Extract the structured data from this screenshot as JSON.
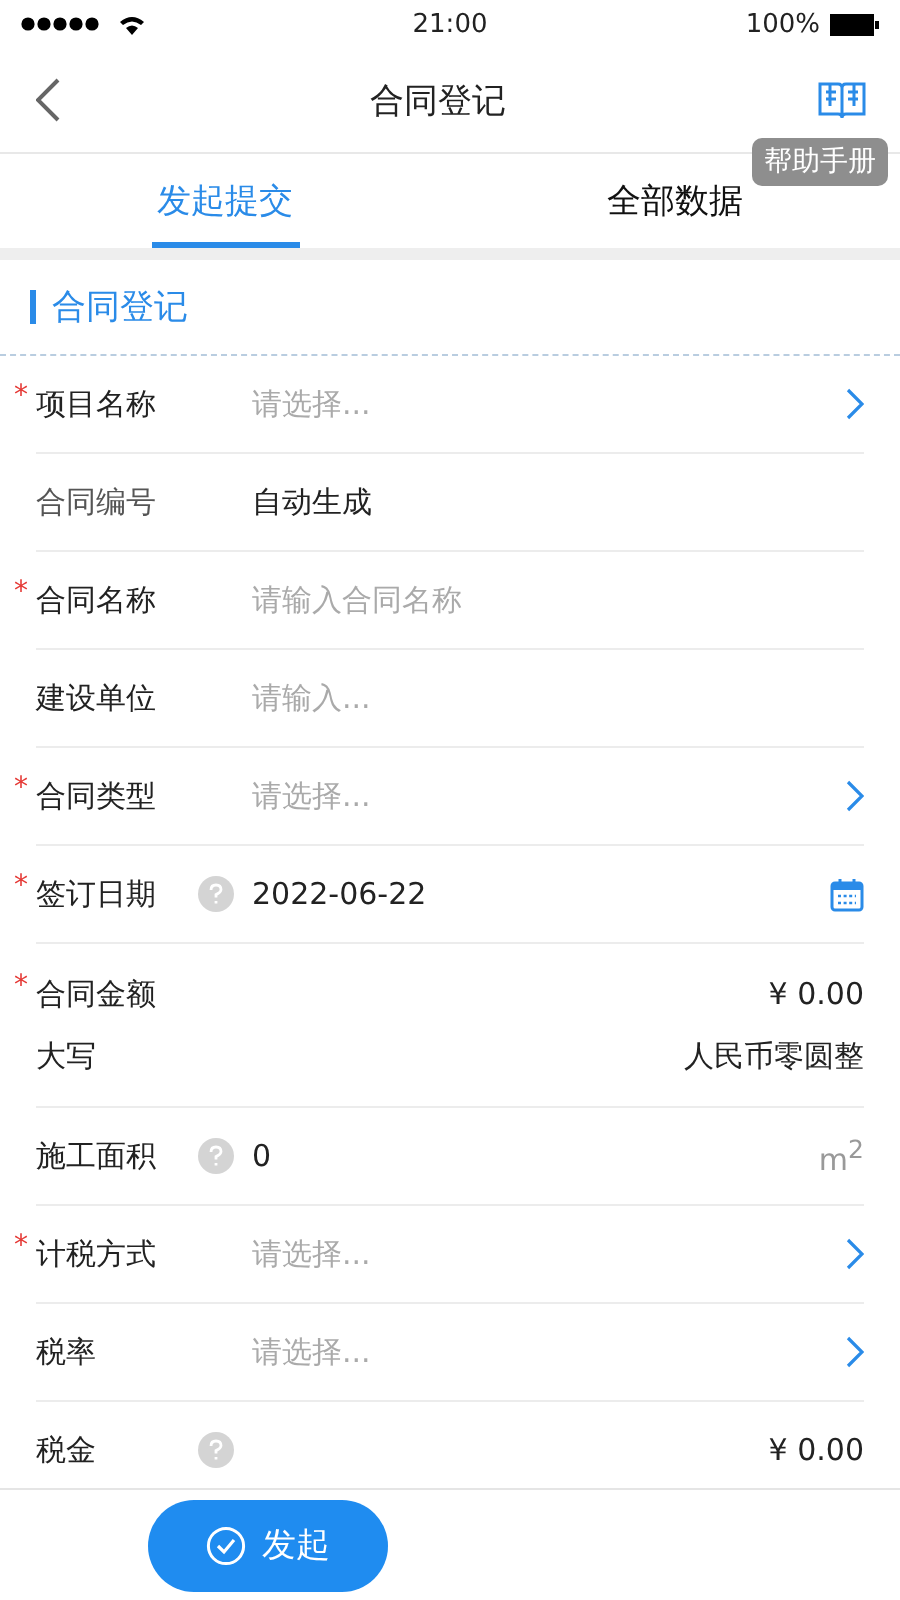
{
  "status_bar": {
    "time": "21:00",
    "battery": "100%"
  },
  "nav": {
    "title": "合同登记",
    "help_tooltip": "帮助手册"
  },
  "tabs": [
    {
      "label": "发起提交",
      "selected": true
    },
    {
      "label": "全部数据",
      "selected": false
    }
  ],
  "section_title": "合同登记",
  "fields": [
    {
      "kind": "select",
      "label": "项目名称",
      "required_mark": "*",
      "placeholder": "请选择..."
    },
    {
      "kind": "text",
      "label": "合同编号",
      "value": "自动生成"
    },
    {
      "kind": "input",
      "label": "合同名称",
      "required_mark": "*",
      "placeholder": "请输入合同名称"
    },
    {
      "kind": "input",
      "label": "建设单位",
      "placeholder": "请输入..."
    },
    {
      "kind": "select",
      "label": "合同类型",
      "required_mark": "*",
      "placeholder": "请选择..."
    },
    {
      "kind": "date",
      "label": "签订日期",
      "required_mark": "*",
      "help": true,
      "value": "2022-06-22"
    },
    {
      "kind": "amount",
      "label": "合同金额",
      "required_mark": "*",
      "value": "¥ 0.00",
      "sub_label": "大写",
      "sub_value": "人民币零圆整"
    },
    {
      "kind": "unit",
      "label": "施工面积",
      "help": true,
      "value": "0",
      "unit": "m$^{2}$"
    },
    {
      "kind": "select",
      "label": "计税方式",
      "required_mark": "*",
      "placeholder": "请选择..."
    },
    {
      "kind": "select",
      "label": "税率",
      "placeholder": "请选择..."
    },
    {
      "kind": "money",
      "label": "税金",
      "help": true,
      "value": "¥ 0.00"
    }
  ],
  "submit_button": "发起"
}
